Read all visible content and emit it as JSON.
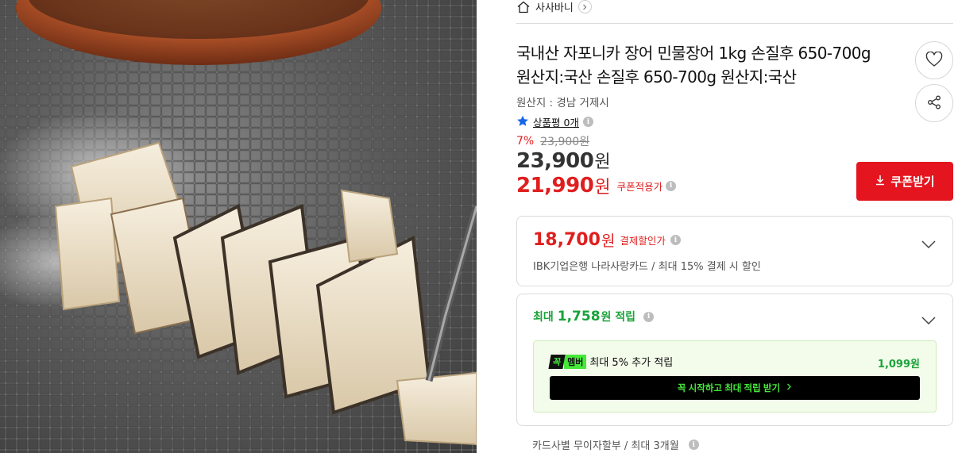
{
  "store": {
    "name": "사사바니",
    "home_icon": "home-icon",
    "chevron_icon": "chevron-right-icon"
  },
  "product": {
    "title": "국내산 자포니카 장어 민물장어 1kg 손질후 650-700g 원산지:국산 손질후 650-700g 원산지:국산",
    "origin": "원산지 : 경남 거제시",
    "review_label": "상품평 0개"
  },
  "price": {
    "discount_rate": "7%",
    "original": "23,900원",
    "sale_amount": "23,900",
    "currency": "원",
    "coupon_amount": "21,990",
    "coupon_label": "쿠폰적용가"
  },
  "actions": {
    "wishlist_icon": "heart-icon",
    "share_icon": "share-icon",
    "coupon_button": "쿠폰받기"
  },
  "payment_discount": {
    "amount": "18,700",
    "currency": "원",
    "label": "결제할인가",
    "description": "IBK기업은행 나라사랑카드 / 최대 15% 결제 시 할인"
  },
  "points": {
    "prefix": "최대",
    "amount": "1,758",
    "suffix": "원 적립",
    "member": {
      "logo_part1": "꼭",
      "logo_part2": "멤버",
      "text": "최대 5% 추가 적립",
      "amount": "1,099원",
      "button_label": "꼭 시작하고 최대 적립 받기"
    }
  },
  "installment": {
    "text": "카드사별 무이자할부 / 최대 3개월"
  },
  "colors": {
    "accent_red": "#e4151f",
    "price_red": "#e01e1e",
    "points_green": "#1aa33a",
    "member_green": "#46e83a"
  }
}
